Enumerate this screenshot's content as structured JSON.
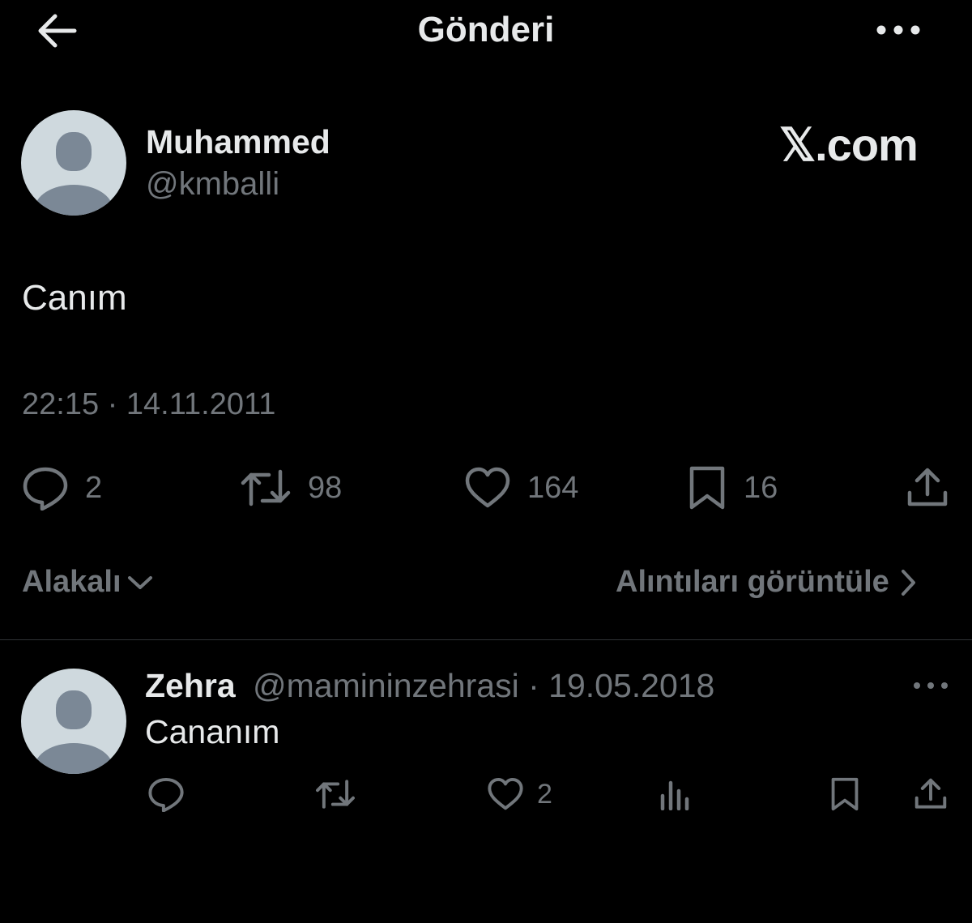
{
  "header": {
    "title": "Gönderi",
    "back_icon": "arrow-left-icon",
    "more_icon": "more-horizontal-icon"
  },
  "brand": {
    "text": "𝕏.com"
  },
  "post": {
    "author_name": "Muhammed",
    "author_handle": "@kmballi",
    "text": "Canım",
    "timestamp": "22:15 · 14.11.2011",
    "metrics": {
      "replies": "2",
      "reposts": "98",
      "likes": "164",
      "bookmarks": "16"
    }
  },
  "filter": {
    "label": "Alakalı",
    "quotes_link": "Alıntıları görüntüle"
  },
  "reply": {
    "author_name": "Zehra",
    "handle_date": "@mamininzehrasi · 19.05.2018",
    "text": "Cananım",
    "likes": "2"
  },
  "colors": {
    "background": "#000000",
    "text": "#e7e9ea",
    "secondary": "#71767b",
    "divider": "#2f3336",
    "avatar_bg": "#cfd9de",
    "avatar_fg": "#7b8896"
  }
}
